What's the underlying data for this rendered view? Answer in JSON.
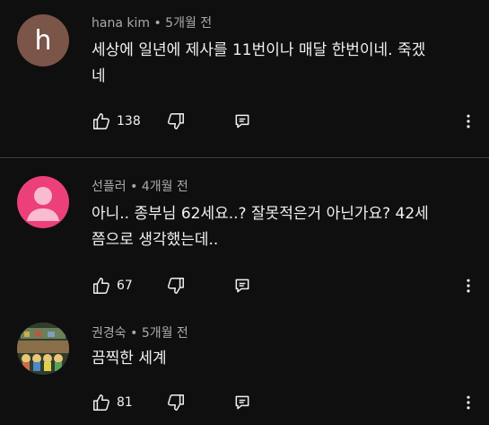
{
  "comments": [
    {
      "author": "hana kim",
      "time": "5개월 전",
      "avatar_letter": "h",
      "text_line1": "세상에 일년에 제사를 11번이나 매달 한번이네. 죽겠",
      "text_line2": "네",
      "likes": "138"
    },
    {
      "author": "선플러",
      "time": "4개월 전",
      "text_line1": "아니..  종부님 62세요..? 잘못적은거 아닌가요? 42세",
      "text_line2": "쯤으로 생각했는데..",
      "likes": "67"
    },
    {
      "author": "권경숙",
      "time": "5개월 전",
      "text_line1": "끔찍한  세계",
      "likes": "81"
    }
  ],
  "separator": " • ",
  "icons": {
    "like": "thumbs-up-icon",
    "dislike": "thumbs-down-icon",
    "reply": "reply-comment-icon",
    "more": "more-vertical-icon"
  },
  "colors": {
    "background": "#0f0f0f",
    "text": "#f1f1f1",
    "meta": "#aaaaaa",
    "avatar_h": "#7a5548",
    "avatar_pink": "#ec407a"
  }
}
